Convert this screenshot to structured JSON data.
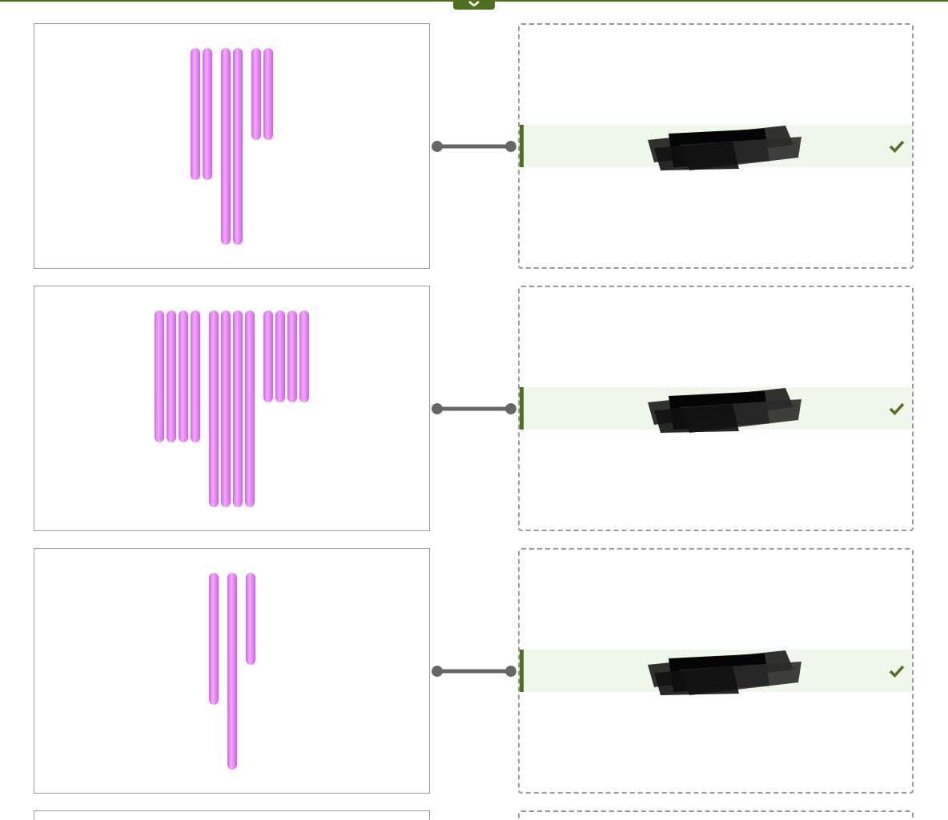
{
  "top_bar": {
    "toggle_tab": {
      "expanded": false
    }
  },
  "matches": [
    {
      "kind": "pair",
      "picture": {
        "groups": [
          {
            "sticks": [
              {
                "kind": "medium"
              },
              {
                "kind": "medium"
              }
            ]
          },
          {
            "sticks": [
              {
                "kind": "long"
              },
              {
                "kind": "long"
              }
            ]
          },
          {
            "sticks": [
              {
                "kind": "short"
              },
              {
                "kind": "short"
              }
            ]
          }
        ]
      },
      "connected": true,
      "answer": {
        "selected": true,
        "correct": true,
        "redacted": true
      }
    },
    {
      "kind": "pair",
      "picture": {
        "groups": [
          {
            "sticks": [
              {
                "kind": "medium"
              },
              {
                "kind": "medium"
              },
              {
                "kind": "medium"
              },
              {
                "kind": "medium"
              }
            ]
          },
          {
            "sticks": [
              {
                "kind": "long"
              },
              {
                "kind": "long"
              },
              {
                "kind": "long"
              },
              {
                "kind": "long"
              }
            ]
          },
          {
            "sticks": [
              {
                "kind": "short"
              },
              {
                "kind": "short"
              },
              {
                "kind": "short"
              },
              {
                "kind": "short"
              }
            ]
          }
        ]
      },
      "connected": true,
      "answer": {
        "selected": true,
        "correct": true,
        "redacted": true
      }
    },
    {
      "kind": "pair",
      "picture": {
        "groups": [
          {
            "sticks": [
              {
                "kind": "medium"
              }
            ]
          },
          {
            "sticks": [
              {
                "kind": "long"
              }
            ]
          },
          {
            "sticks": [
              {
                "kind": "short"
              }
            ]
          }
        ]
      },
      "connected": true,
      "answer": {
        "selected": true,
        "correct": true,
        "redacted": true
      }
    },
    {
      "kind": "pair"
    }
  ]
}
